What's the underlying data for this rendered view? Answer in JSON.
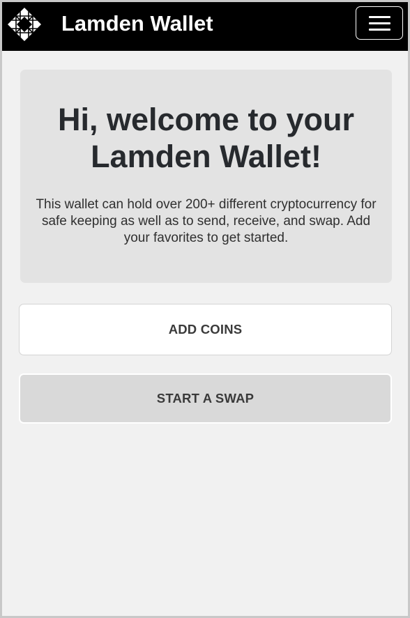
{
  "header": {
    "logo_icon": "lamden-logo-icon",
    "title": "Lamden Wallet",
    "menu_icon": "hamburger-menu-icon"
  },
  "hero": {
    "title": "Hi, welcome to your Lamden Wallet!",
    "description": "This wallet can hold over 200+ different cryptocurrency for safe keeping as well as to send, receive, and swap. Add your favorites to get started."
  },
  "actions": {
    "add_coins_label": "ADD COINS",
    "start_swap_label": "START A SWAP"
  },
  "colors": {
    "navbar": "#000000",
    "page_background": "#f1f1f1",
    "hero_background": "#e3e3e3",
    "primary_button": "#ffffff",
    "secondary_button": "#d9d9d9",
    "title_text": "#272a2e"
  }
}
